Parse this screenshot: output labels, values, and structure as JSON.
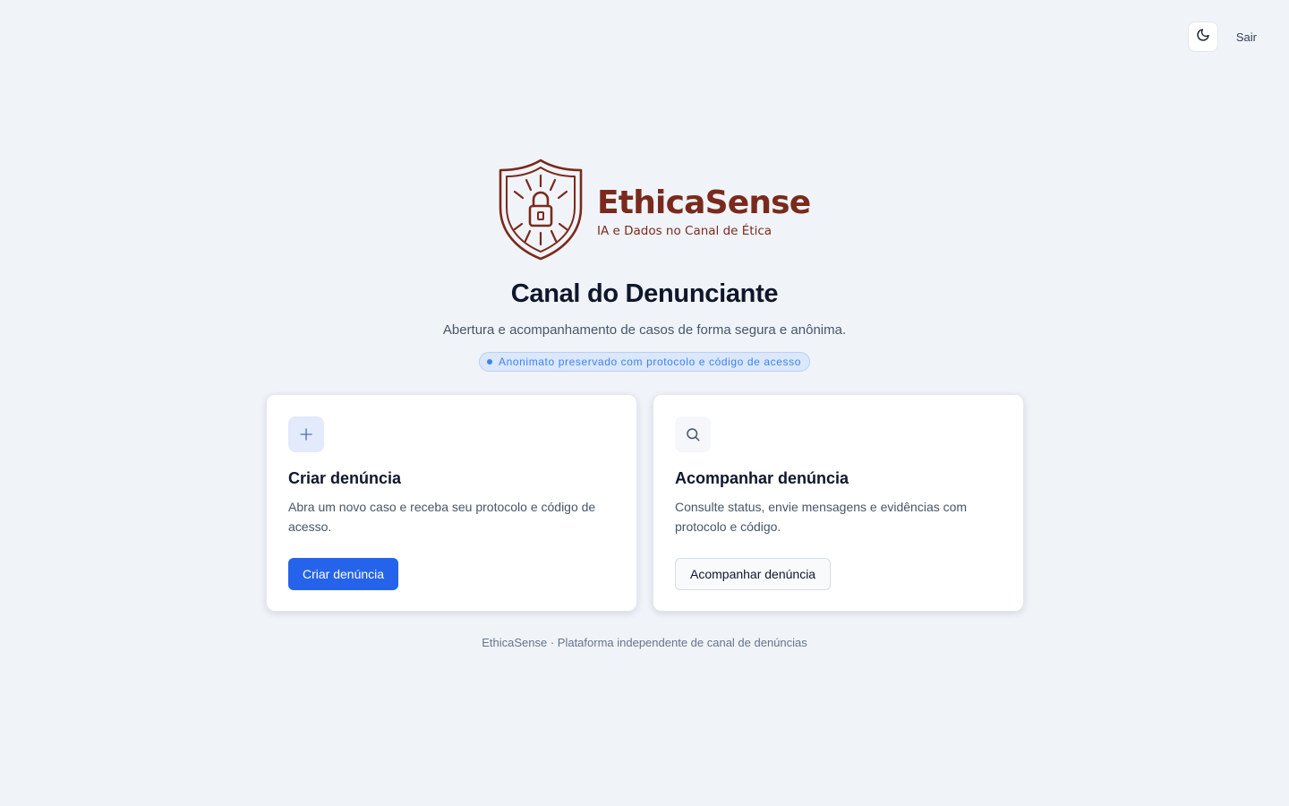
{
  "header": {
    "theme_toggle_icon": "moon-icon",
    "logout_label": "Sair"
  },
  "brand": {
    "name": "EthicaSense",
    "tagline": "IA e Dados no Canal de Ética",
    "logo_icon": "shield-lock-icon",
    "color": "#7a2a1c"
  },
  "hero": {
    "title": "Canal do Denunciante",
    "subtitle": "Abertura e acompanhamento de casos de forma segura e anônima.",
    "badge": "Anonimato preservado com protocolo e código de acesso"
  },
  "cards": [
    {
      "icon": "plus-icon",
      "title": "Criar denúncia",
      "description": "Abra um novo caso e receba seu protocolo e código de acesso.",
      "button_label": "Criar denúncia"
    },
    {
      "icon": "search-icon",
      "title": "Acompanhar denúncia",
      "description": "Consulte status, envie mensagens e evidências com protocolo e código.",
      "button_label": "Acompanhar denúncia"
    }
  ],
  "footer": {
    "text": "EthicaSense · Plataforma independente de canal de denúncias"
  },
  "colors": {
    "background": "#f0f4f9",
    "primary": "#2563eb",
    "badge_text": "#3b82f6"
  }
}
